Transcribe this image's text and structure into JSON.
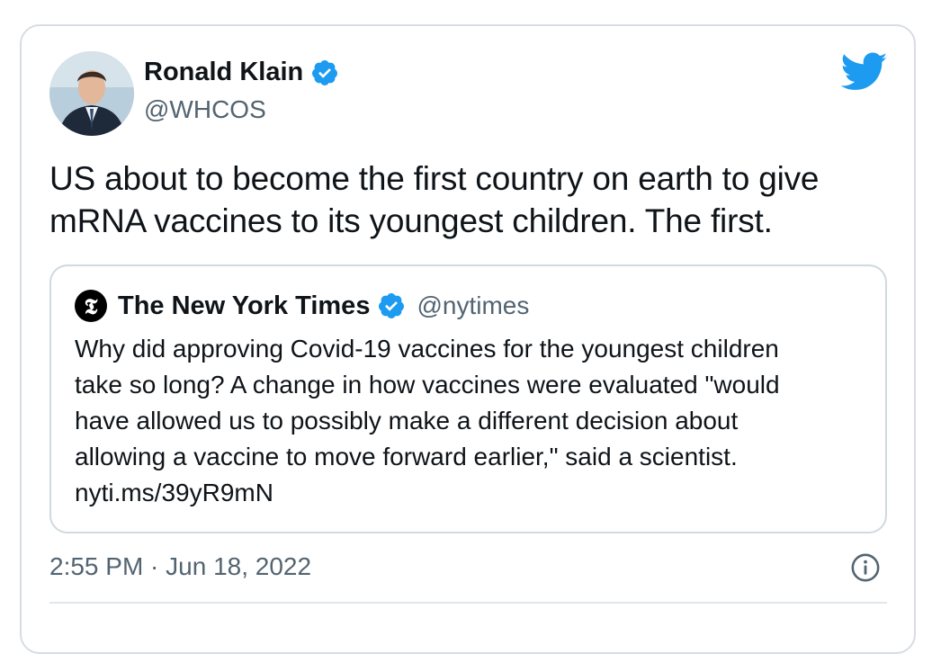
{
  "author": {
    "name": "Ronald Klain",
    "handle": "@WHCOS",
    "verified": true
  },
  "tweet": {
    "lines": [
      "US about to become the first country on earth to give",
      "mRNA vaccines to its youngest children.  The first."
    ]
  },
  "quoted": {
    "name": "The New York Times",
    "handle": "@nytimes",
    "verified": true,
    "logo_glyph": "𝕿",
    "lines": [
      "Why did approving Covid-19 vaccines for the youngest children",
      "take so long? A change in how vaccines were evaluated \"would",
      "have allowed us to possibly make a different decision about",
      "allowing a vaccine to move forward earlier,\" said a scientist.",
      "nyti.ms/39yR9mN"
    ]
  },
  "meta": {
    "timestamp": "2:55 PM · Jun 18, 2022"
  },
  "icons": {
    "brand": "twitter-bird-icon",
    "info": "info-icon",
    "verified": "verified-badge-icon"
  },
  "colors": {
    "twitter_blue": "#1d9bf0",
    "text_primary": "#0f1419",
    "text_secondary": "#536471",
    "border": "#cfd9de"
  }
}
